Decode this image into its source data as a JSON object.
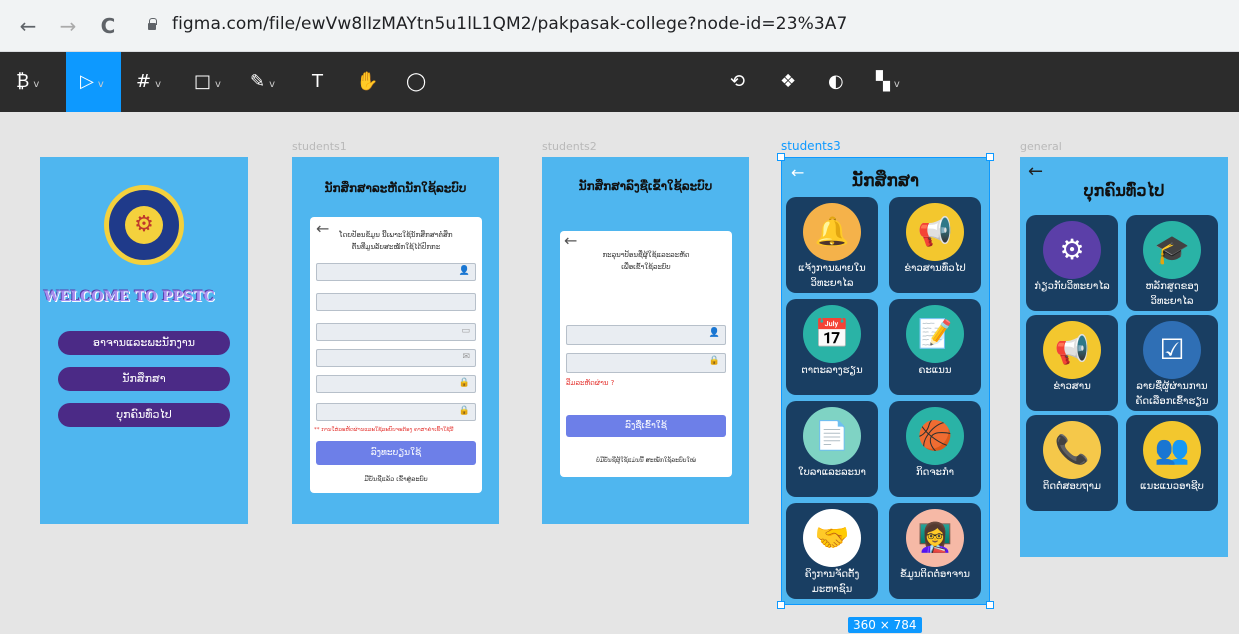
{
  "browser": {
    "url": "figma.com/file/ewVw8lIzMAYtn5u1lL1QM2/pakpasak-college?node-id=23%3A7",
    "back": "←",
    "forward": "→",
    "reload": "C"
  },
  "toolbar": {
    "menu": "₿",
    "move": "▷",
    "frame": "#",
    "shape": "□",
    "pen": "✎",
    "text": "T",
    "hand": "✋",
    "comment": "◯",
    "right1": "⟲",
    "right2": "❖",
    "right3": "◐",
    "right4": "▚"
  },
  "frames": {
    "f2_label": "students1",
    "f3_label": "students2",
    "f4_label": "students3",
    "f5_label": "general",
    "f4_dims": "360 × 784"
  },
  "welcome": {
    "title": "WELCOME TO PPSTC",
    "btn1": "ອາຈານແລະພະນັກງານ",
    "btn2": "ນັກສຶກສາ",
    "btn3": "ບຸກຄົນທົ່ວໄປ"
  },
  "register": {
    "title": "ນັກສຶກສາລະຫັດນັກໃຊ້ລະບົບ",
    "intro1": "ໂດຍປ້ອນຂໍ້ມູນ ນີ້ເພາະໃຊ້ນັກສຶກສາຕໍ່ສຶກ",
    "intro2": "ຕົ້ນທີ່ມູນລັບສະໝັກໃຊ້ໄດ້ປົກກະ",
    "warning": "** ການໃສ່ລະຫັດຜ່ານແລະໃຊ້ລະບົບຈະຕ້ອງ ຄາສາຄໍາເຂົ້າໃຊ້ນີ້",
    "button": "ລົງທະບຽນໃຊ້",
    "footer": "ມີບັນຊີແລ້ວ ເຂົ້າສູ່ລະບົບ"
  },
  "login": {
    "title": "ນັກສຶກສາລົງຊື່ເຂົ້າໃຊ້ລະບົບ",
    "intro1": "ກະລຸນາປ້ອນຊື່ຜູ້ໃຊ້ແລະລະຫັດ",
    "intro2": "ເພື່ອເຂົ້າໃຊ້ລະບົບ",
    "forgot": "ລືມລະຫັດຜ່ານ ?",
    "button": "ລົງຊື່ເຂົ້າໃຊ້",
    "footer": "ບໍ່ມີບັນຊີຜູ້ໃຊ້ແມ່ນນີ້ ສະໝັກໃຊ້ລະບົບໃໝ່"
  },
  "students": {
    "title": "ນັກສຶກສາ",
    "tiles": [
      {
        "label": "ແຈ້ງການພາຍໃນ ວິທະຍາໄລ",
        "icon": "bell-icon",
        "glyph": "🔔",
        "color": "#f5b24a"
      },
      {
        "label": "ຂ່າວສານທົ່ວໄປ",
        "icon": "megaphone-icon",
        "glyph": "📢",
        "color": "#f3c72e"
      },
      {
        "label": "ຕາຕະລາງຮຽນ",
        "icon": "calendar-icon",
        "glyph": "📅",
        "color": "#2ab3a6"
      },
      {
        "label": "ຄະແນນ",
        "icon": "notes-icon",
        "glyph": "📝",
        "color": "#2ab3a6"
      },
      {
        "label": "ໃບລາແລະລະນາ",
        "icon": "document-icon",
        "glyph": "📄",
        "color": "#7fd3c4"
      },
      {
        "label": "ກິດຈະກຳ",
        "icon": "activity-icon",
        "glyph": "🏀",
        "color": "#2ab3a6"
      },
      {
        "label": "ຄິງການຈັດຕັ້ງ ມະຫາຊົນ",
        "icon": "team-hands-icon",
        "glyph": "🤝",
        "color": "#ffffff"
      },
      {
        "label": "ຂໍ້ມູນຕິດຕໍ່ອາຈານ",
        "icon": "teacher-icon",
        "glyph": "👩‍🏫",
        "color": "#f6b9a6"
      }
    ]
  },
  "general": {
    "title": "ບຸກຄົນທົ່ວໄປ",
    "tiles": [
      {
        "label": "ກ່ຽວກັບວິທະຍາໄລ",
        "icon": "college-logo-icon",
        "glyph": "⚙",
        "color": "#5b3fa8"
      },
      {
        "label": "ຫລັກສູດຂອງ ວິທະຍາໄລ",
        "icon": "graduation-icon",
        "glyph": "🎓",
        "color": "#2ab3a6"
      },
      {
        "label": "ຂ່າວສານ",
        "icon": "megaphone-icon",
        "glyph": "📢",
        "color": "#f3c72e"
      },
      {
        "label": "ລາຍຊື່ຜູ້ຜ່ານການ ຄັດເລືອກເຂົ້າຮຽນ",
        "icon": "checkbox-icon",
        "glyph": "☑",
        "color": "#2f6fb5"
      },
      {
        "label": "ຕິດຕໍ່ສອບຖາມ",
        "icon": "phone-icon",
        "glyph": "📞",
        "color": "#f5c84a"
      },
      {
        "label": "ແນະແນວອາຊີບ",
        "icon": "career-icon",
        "glyph": "👥",
        "color": "#f3c72e"
      }
    ]
  }
}
